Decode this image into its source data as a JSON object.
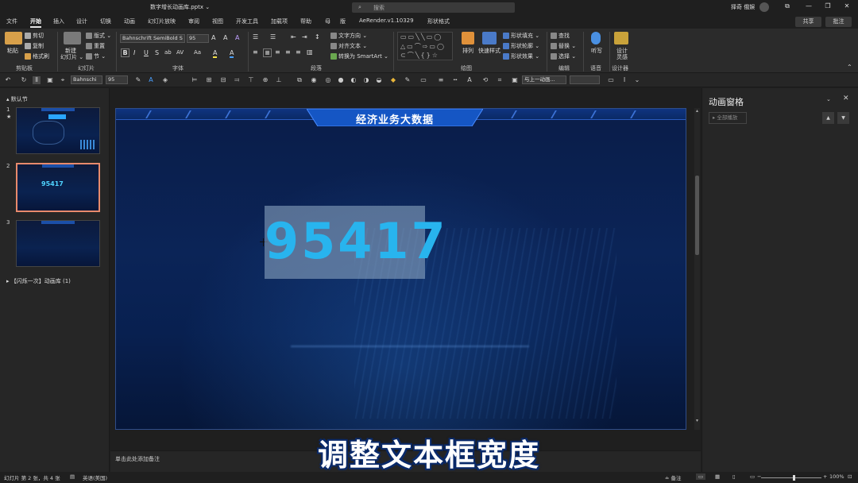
{
  "titlebar": {
    "doc_title": "数字增长动画库.pptx ⌄",
    "search_placeholder": "搜索",
    "user_name": "择奇 俄娱",
    "buttons": [
      "⧉",
      "—",
      "❐",
      "✕"
    ]
  },
  "menu": {
    "tabs": [
      "文件",
      "开始",
      "插入",
      "设计",
      "切换",
      "动画",
      "幻灯片放映",
      "审阅",
      "视图",
      "开发工具",
      "加载项",
      "帮助",
      "母",
      "版",
      "AeRender.v1.10329",
      "形状格式"
    ],
    "active": "开始",
    "share": "共享",
    "comment": "批注"
  },
  "ribbon": {
    "clipboard": {
      "paste": "粘贴",
      "cut": "剪切",
      "copy": "复制",
      "format_painter": "格式刷",
      "label": "剪贴板"
    },
    "slides": {
      "new_slide": "新建",
      "new_slide2": "幻灯片 ⌄",
      "layout": "版式 ⌄",
      "reset": "重置",
      "section": "节 ⌄",
      "label": "幻灯片"
    },
    "font": {
      "font_name": "Bahnschrift SemiBold S",
      "font_size": "95",
      "label": "字体",
      "buttons": [
        "B",
        "I",
        "U",
        "S",
        "ab",
        "AV",
        "Aa",
        "A",
        "A"
      ]
    },
    "paragraph": {
      "text_direction": "文字方向 ⌄",
      "align_text": "对齐文本 ⌄",
      "smartart": "转换为 SmartArt ⌄",
      "label": "段落"
    },
    "drawing": {
      "arrange": "排列",
      "quick_styles": "快速样式",
      "fill": "形状填充 ⌄",
      "outline": "形状轮廓 ⌄",
      "effects": "形状效果 ⌄",
      "label": "绘图"
    },
    "editing": {
      "find": "查找",
      "replace": "替换 ⌄",
      "select": "选择 ⌄",
      "label": "编辑"
    },
    "voice": {
      "dictate": "听写",
      "label": "语音"
    },
    "designer": {
      "design_ideas": "设计",
      "design_ideas2": "灵感",
      "label": "设计器"
    }
  },
  "qat": {
    "font_name": "Bahnschi",
    "font_size": "95",
    "animation_dropdown": "与上一动画..."
  },
  "thumbnails": {
    "section_label": "默认节",
    "slides": [
      {
        "num": "1",
        "star": "★"
      },
      {
        "num": "2",
        "value": "95417"
      },
      {
        "num": "3"
      }
    ],
    "group2_label": "【闪烁一次】动画库 (1)"
  },
  "slide": {
    "title": "经济业务大数据",
    "number": "95417"
  },
  "notes": {
    "placeholder": "单击此处添加备注"
  },
  "animation_pane": {
    "title": "动画窗格",
    "play_all": "全部播放",
    "move_up": "▲",
    "move_down": "▼"
  },
  "statusbar": {
    "slide_info": "幻灯片 第 2 张，共 4 张",
    "language": "英语(美国)",
    "notes": "备注",
    "zoom": "100%"
  },
  "subtitle": "调整文本框宽度"
}
